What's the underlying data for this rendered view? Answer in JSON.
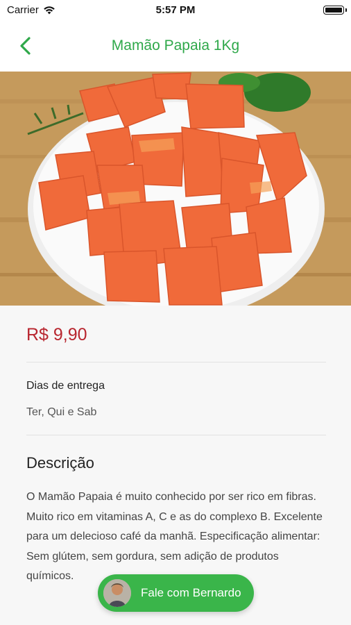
{
  "status_bar": {
    "carrier": "Carrier",
    "time": "5:57 PM",
    "icons": [
      "wifi-icon",
      "battery-icon"
    ]
  },
  "header": {
    "title": "Mamão Papaia 1Kg",
    "back_icon": "chevron-left-icon",
    "accent_color": "#2fa84a"
  },
  "product": {
    "price": "R$ 9,90",
    "price_color": "#b8262f",
    "delivery_label": "Dias de entrega",
    "delivery_days": "Ter, Qui e Sab",
    "description_title": "Descrição",
    "description": "O Mamão Papaia é muito conhecido por ser rico em fibras. Muito rico em vitaminas A, C e as do complexo B. Excelente para um delecioso café da manhã. Especificação alimentar: Sem glútem, sem gordura, sem adição de produtos químicos."
  },
  "chat_button": {
    "label": "Fale com Bernardo",
    "color": "#3ab54a"
  }
}
